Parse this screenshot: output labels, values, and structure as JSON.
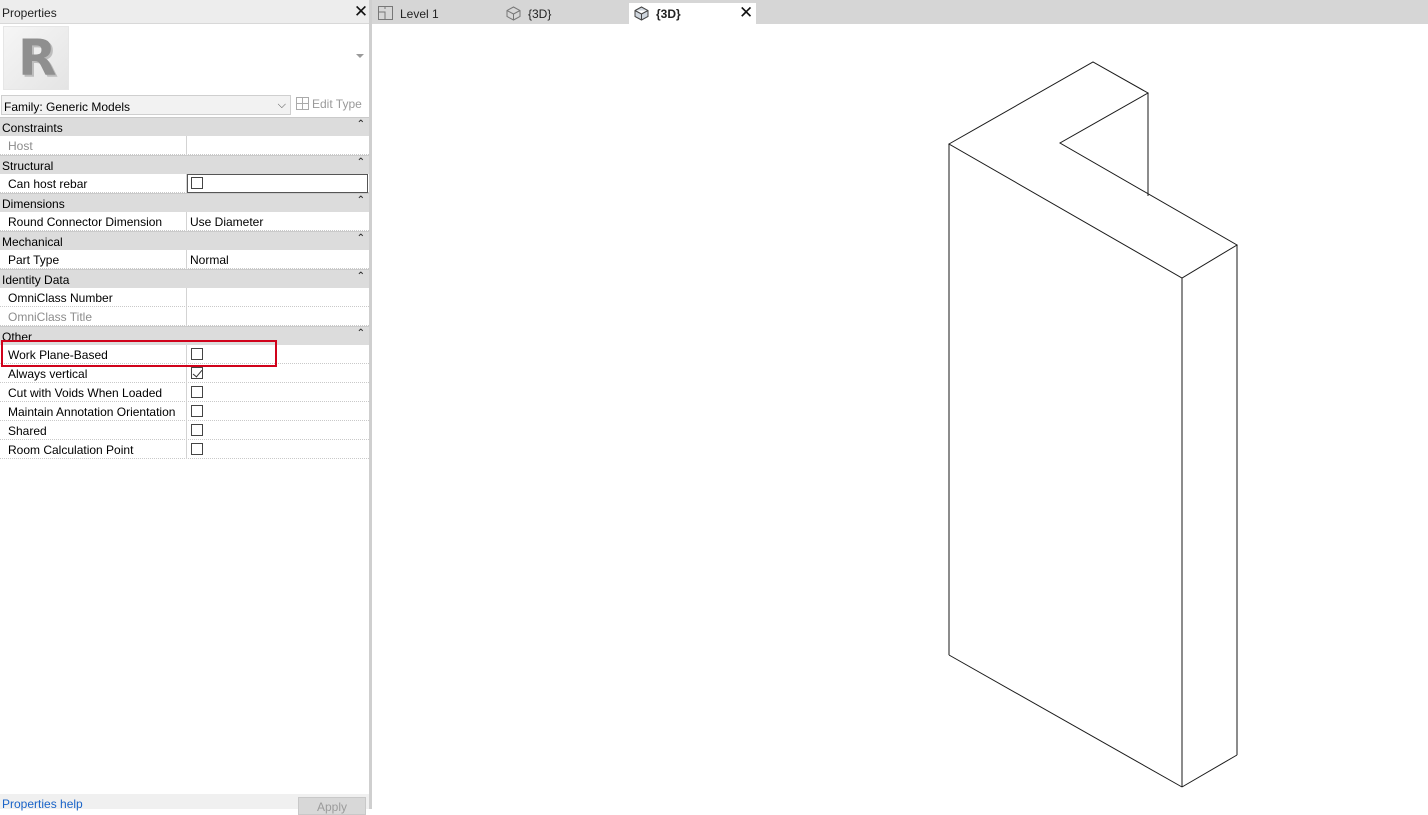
{
  "properties": {
    "title": "Properties",
    "family_selector": "Family: Generic Models",
    "edit_type_label": "Edit Type",
    "groups": [
      {
        "name": "Constraints",
        "rows": [
          {
            "label": "Host",
            "value": ""
          }
        ]
      },
      {
        "name": "Structural",
        "rows": [
          {
            "label": "Can host rebar",
            "checked": false
          }
        ]
      },
      {
        "name": "Dimensions",
        "rows": [
          {
            "label": "Round Connector Dimension",
            "value": "Use Diameter"
          }
        ]
      },
      {
        "name": "Mechanical",
        "rows": [
          {
            "label": "Part Type",
            "value": "Normal"
          }
        ]
      },
      {
        "name": "Identity Data",
        "rows": [
          {
            "label": "OmniClass Number",
            "value": ""
          },
          {
            "label": "OmniClass Title",
            "value": ""
          }
        ]
      },
      {
        "name": "Other",
        "rows": [
          {
            "label": "Work Plane-Based",
            "checked": false
          },
          {
            "label": "Always vertical",
            "checked": true
          },
          {
            "label": "Cut with Voids When Loaded",
            "checked": false
          },
          {
            "label": "Maintain Annotation Orientation",
            "checked": false
          },
          {
            "label": "Shared",
            "checked": false
          },
          {
            "label": "Room Calculation Point",
            "checked": false
          }
        ]
      }
    ],
    "help_link": "Properties help",
    "apply_label": "Apply",
    "highlight_color": "#d0021b"
  },
  "tabs": [
    {
      "label": "Level 1",
      "icon": "floor-plan-icon",
      "active": false
    },
    {
      "label": "{3D}",
      "icon": "3d-view-icon",
      "active": false
    },
    {
      "label": "{3D}",
      "icon": "3d-view-icon",
      "active": true
    }
  ],
  "viewport": {
    "content": "isometric wireframe of L-shaped generic model"
  }
}
